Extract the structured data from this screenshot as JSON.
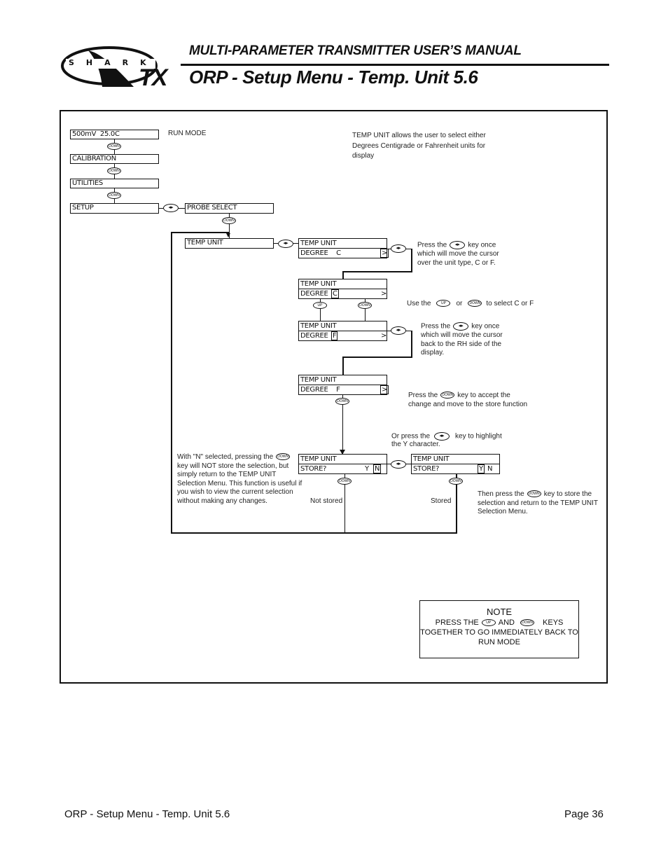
{
  "header": {
    "logo_text": "SHARK",
    "logo_tx": "TX",
    "manual_title": "MULTI-PARAMETER TRANSMITTER USER’S MANUAL",
    "page_title": "ORP - Setup Menu - Temp. Unit 5.6"
  },
  "keys": {
    "down": "DOWN",
    "up": "UP",
    "left_right": "◂▸"
  },
  "menu": {
    "run_display": "500mV  25.0C",
    "run_label": "RUN MODE",
    "calibration": "CALIBRATION",
    "utilities": "UTILITIES",
    "setup": "SETUP",
    "probe_select": "PROBE SELECT",
    "temp_unit": "TEMP UNIT"
  },
  "intro_note": "TEMP UNIT allows the user to select either Degrees Centigrade or Fahrenheit units for display",
  "screens": {
    "s1": {
      "line1": "TEMP UNIT",
      "line2": "DEGREE    C",
      "cursor": ">"
    },
    "s2": {
      "line1": "TEMP UNIT",
      "line2": "DEGREE",
      "cursor": "C",
      "arrow": ">"
    },
    "s3": {
      "line1": "TEMP UNIT",
      "line2": "DEGREE",
      "cursor": "F",
      "arrow": ">"
    },
    "s4": {
      "line1": "TEMP UNIT",
      "line2": "DEGREE    F",
      "cursor": ">"
    },
    "s5": {
      "line1": "TEMP UNIT",
      "line2": "STORE?",
      "y": "Y",
      "cursor": "N"
    },
    "s6": {
      "line1": "TEMP UNIT",
      "line2": "STORE?",
      "cursor": "Y",
      "n": "N"
    }
  },
  "notes": {
    "n1_a": "Press the",
    "n1_b": "key once",
    "n1_c": "which will move the cursor",
    "n1_d": "over the unit type, C or F.",
    "n2_a": "Use the",
    "n2_b": "or",
    "n2_c": "to select C or F",
    "n3_a": "Press the",
    "n3_b": "key once",
    "n3_c": "which will move the cursor",
    "n3_d": "back to the RH side of the",
    "n3_e": "display.",
    "n4_a": "Press the",
    "n4_b": "key to accept the",
    "n4_c": "change and move to the store function",
    "n5_a": "Or press the",
    "n5_b": "key to highlight",
    "n5_c": "the Y character.",
    "n6_a": "With \"N\" selected, pressing the",
    "n6_b": "key will NOT store the selection, but",
    "n6_c": "simply return to the TEMP UNIT",
    "n6_d": "Selection Menu. This function is useful if",
    "n6_e": "you wish to view the current selection",
    "n6_f": "without making any changes.",
    "not_stored": "Not stored",
    "stored": "Stored",
    "n7_a": "Then press the",
    "n7_b": "key to store the",
    "n7_c": "selection and return to the TEMP UNIT",
    "n7_d": "Selection Menu."
  },
  "notebox": {
    "title": "NOTE",
    "line1_a": "PRESS THE",
    "line1_b": "AND",
    "line1_c": "KEYS",
    "line2": "TOGETHER TO GO IMMEDIATELY BACK TO",
    "line3": "RUN MODE"
  },
  "footer": {
    "left": "ORP - Setup Menu - Temp. Unit 5.6",
    "right": "Page 36"
  }
}
